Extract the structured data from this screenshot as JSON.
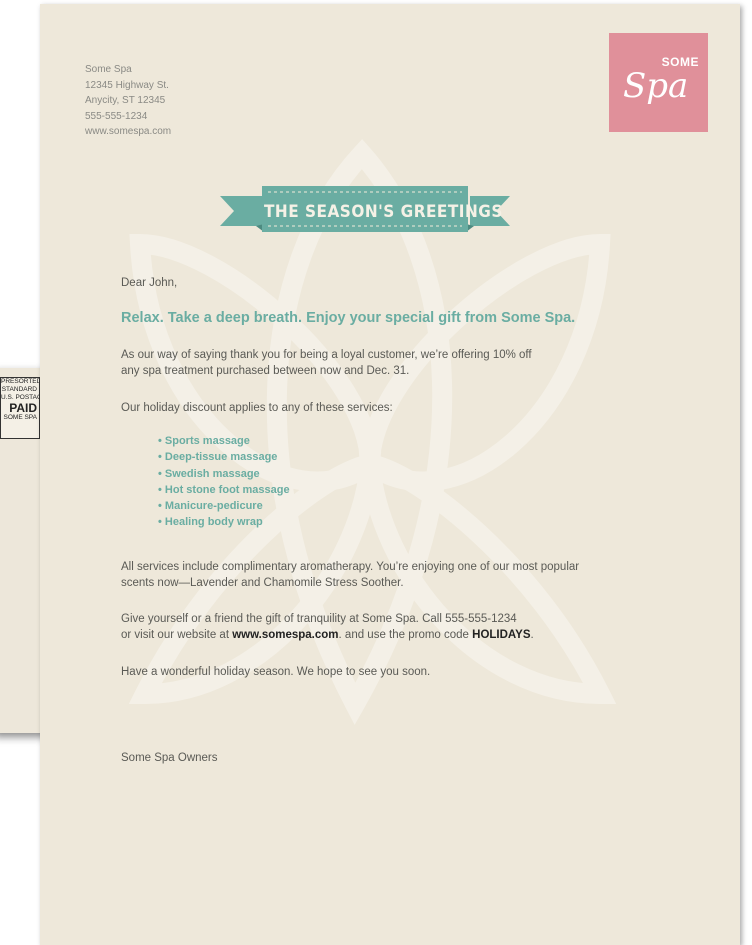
{
  "envelope": {
    "postage_lines": [
      "PRESORTED",
      "STANDARD",
      "U.S. POSTAGE"
    ],
    "postage_paid": "PAID",
    "postage_sender": "SOME SPA"
  },
  "sender": {
    "name": "Some Spa",
    "street": "12345 Highway St.",
    "city": "Anycity, ST 12345",
    "phone": "555-555-1234",
    "website": "www.somespa.com"
  },
  "logo": {
    "top": "SOME",
    "script": "Spa",
    "bg_color": "#e0909a"
  },
  "banner": {
    "text": "THE SEASON'S GREETINGS",
    "color": "#6aada2"
  },
  "letter": {
    "greeting": "Dear John,",
    "headline": "Relax. Take a deep breath. Enjoy your special gift from Some Spa.",
    "p1_line1": "As our way of saying thank you for being a loyal customer, we’re offering 10% off",
    "p1_line2": "any spa treatment purchased between now and Dec. 31.",
    "p2": "Our holiday discount applies to any of these services:",
    "services": [
      "• Sports massage",
      "• Deep-tissue massage",
      "• Swedish massage",
      "• Hot stone foot massage",
      "• Manicure-pedicure",
      "• Healing body wrap"
    ],
    "p3_line1": "All services include complimentary aromatherapy. You’re enjoying one of our most popular",
    "p3_line2": "scents now—Lavender and Chamomile Stress Soother.",
    "p4_line1": "Give yourself or a friend the gift of tranquility at Some Spa. Call 555-555-1234",
    "p4_pre": "or visit our website at ",
    "p4_url": "www.somespa.com",
    "p4_mid": ". and use the promo code ",
    "p4_code": "HOLIDAYS",
    "p4_end": ".",
    "p5": "Have a wonderful holiday season. We hope to see you soon.",
    "signature": "Some Spa Owners"
  },
  "colors": {
    "paper": "#eee8da",
    "accent": "#6aada2",
    "text": "#5a5a55"
  }
}
